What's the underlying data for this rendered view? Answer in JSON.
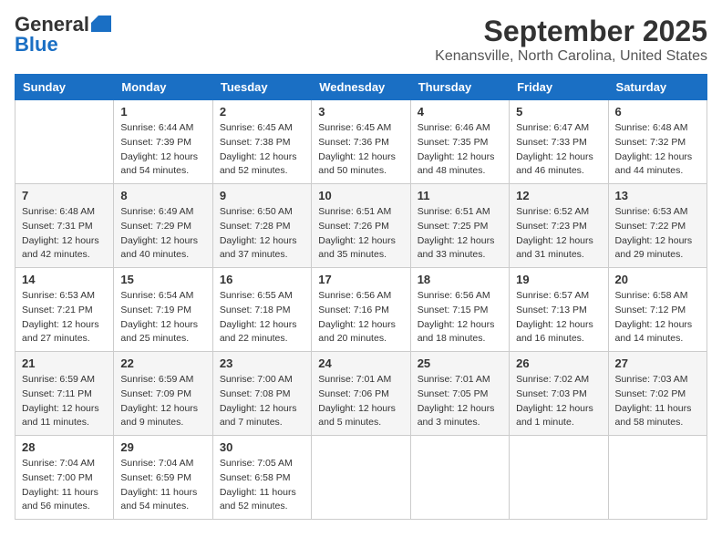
{
  "header": {
    "logo_general": "General",
    "logo_blue": "Blue",
    "month_title": "September 2025",
    "location": "Kenansville, North Carolina, United States"
  },
  "days_of_week": [
    "Sunday",
    "Monday",
    "Tuesday",
    "Wednesday",
    "Thursday",
    "Friday",
    "Saturday"
  ],
  "weeks": [
    [
      {
        "day": "",
        "info": ""
      },
      {
        "day": "1",
        "info": "Sunrise: 6:44 AM\nSunset: 7:39 PM\nDaylight: 12 hours\nand 54 minutes."
      },
      {
        "day": "2",
        "info": "Sunrise: 6:45 AM\nSunset: 7:38 PM\nDaylight: 12 hours\nand 52 minutes."
      },
      {
        "day": "3",
        "info": "Sunrise: 6:45 AM\nSunset: 7:36 PM\nDaylight: 12 hours\nand 50 minutes."
      },
      {
        "day": "4",
        "info": "Sunrise: 6:46 AM\nSunset: 7:35 PM\nDaylight: 12 hours\nand 48 minutes."
      },
      {
        "day": "5",
        "info": "Sunrise: 6:47 AM\nSunset: 7:33 PM\nDaylight: 12 hours\nand 46 minutes."
      },
      {
        "day": "6",
        "info": "Sunrise: 6:48 AM\nSunset: 7:32 PM\nDaylight: 12 hours\nand 44 minutes."
      }
    ],
    [
      {
        "day": "7",
        "info": "Sunrise: 6:48 AM\nSunset: 7:31 PM\nDaylight: 12 hours\nand 42 minutes."
      },
      {
        "day": "8",
        "info": "Sunrise: 6:49 AM\nSunset: 7:29 PM\nDaylight: 12 hours\nand 40 minutes."
      },
      {
        "day": "9",
        "info": "Sunrise: 6:50 AM\nSunset: 7:28 PM\nDaylight: 12 hours\nand 37 minutes."
      },
      {
        "day": "10",
        "info": "Sunrise: 6:51 AM\nSunset: 7:26 PM\nDaylight: 12 hours\nand 35 minutes."
      },
      {
        "day": "11",
        "info": "Sunrise: 6:51 AM\nSunset: 7:25 PM\nDaylight: 12 hours\nand 33 minutes."
      },
      {
        "day": "12",
        "info": "Sunrise: 6:52 AM\nSunset: 7:23 PM\nDaylight: 12 hours\nand 31 minutes."
      },
      {
        "day": "13",
        "info": "Sunrise: 6:53 AM\nSunset: 7:22 PM\nDaylight: 12 hours\nand 29 minutes."
      }
    ],
    [
      {
        "day": "14",
        "info": "Sunrise: 6:53 AM\nSunset: 7:21 PM\nDaylight: 12 hours\nand 27 minutes."
      },
      {
        "day": "15",
        "info": "Sunrise: 6:54 AM\nSunset: 7:19 PM\nDaylight: 12 hours\nand 25 minutes."
      },
      {
        "day": "16",
        "info": "Sunrise: 6:55 AM\nSunset: 7:18 PM\nDaylight: 12 hours\nand 22 minutes."
      },
      {
        "day": "17",
        "info": "Sunrise: 6:56 AM\nSunset: 7:16 PM\nDaylight: 12 hours\nand 20 minutes."
      },
      {
        "day": "18",
        "info": "Sunrise: 6:56 AM\nSunset: 7:15 PM\nDaylight: 12 hours\nand 18 minutes."
      },
      {
        "day": "19",
        "info": "Sunrise: 6:57 AM\nSunset: 7:13 PM\nDaylight: 12 hours\nand 16 minutes."
      },
      {
        "day": "20",
        "info": "Sunrise: 6:58 AM\nSunset: 7:12 PM\nDaylight: 12 hours\nand 14 minutes."
      }
    ],
    [
      {
        "day": "21",
        "info": "Sunrise: 6:59 AM\nSunset: 7:11 PM\nDaylight: 12 hours\nand 11 minutes."
      },
      {
        "day": "22",
        "info": "Sunrise: 6:59 AM\nSunset: 7:09 PM\nDaylight: 12 hours\nand 9 minutes."
      },
      {
        "day": "23",
        "info": "Sunrise: 7:00 AM\nSunset: 7:08 PM\nDaylight: 12 hours\nand 7 minutes."
      },
      {
        "day": "24",
        "info": "Sunrise: 7:01 AM\nSunset: 7:06 PM\nDaylight: 12 hours\nand 5 minutes."
      },
      {
        "day": "25",
        "info": "Sunrise: 7:01 AM\nSunset: 7:05 PM\nDaylight: 12 hours\nand 3 minutes."
      },
      {
        "day": "26",
        "info": "Sunrise: 7:02 AM\nSunset: 7:03 PM\nDaylight: 12 hours\nand 1 minute."
      },
      {
        "day": "27",
        "info": "Sunrise: 7:03 AM\nSunset: 7:02 PM\nDaylight: 11 hours\nand 58 minutes."
      }
    ],
    [
      {
        "day": "28",
        "info": "Sunrise: 7:04 AM\nSunset: 7:00 PM\nDaylight: 11 hours\nand 56 minutes."
      },
      {
        "day": "29",
        "info": "Sunrise: 7:04 AM\nSunset: 6:59 PM\nDaylight: 11 hours\nand 54 minutes."
      },
      {
        "day": "30",
        "info": "Sunrise: 7:05 AM\nSunset: 6:58 PM\nDaylight: 11 hours\nand 52 minutes."
      },
      {
        "day": "",
        "info": ""
      },
      {
        "day": "",
        "info": ""
      },
      {
        "day": "",
        "info": ""
      },
      {
        "day": "",
        "info": ""
      }
    ]
  ]
}
